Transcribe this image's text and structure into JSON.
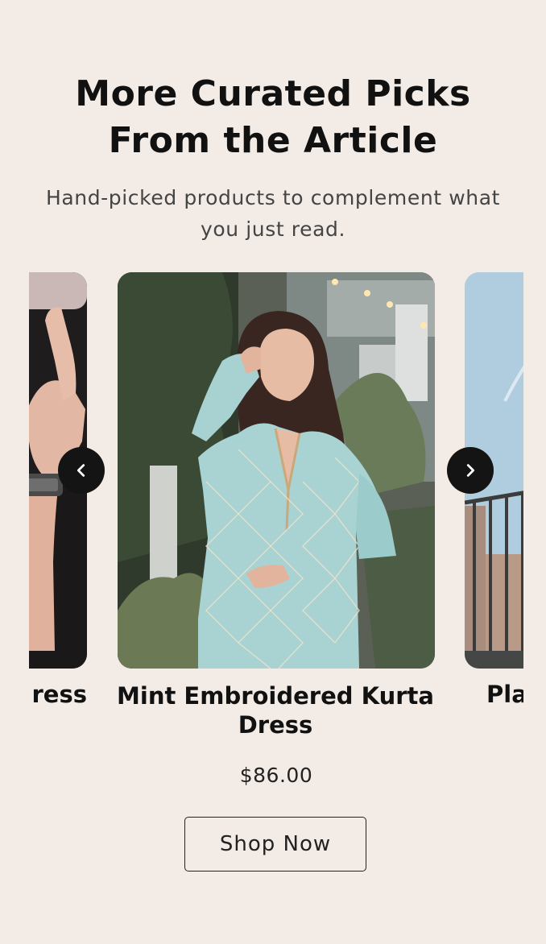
{
  "section": {
    "title_line1": "More Curated Picks",
    "title_line2": "From the Article",
    "subtitle_line1": "Hand-picked products to complement what",
    "subtitle_line2": "you just read."
  },
  "carousel": {
    "prev_icon": "chevron-left-icon",
    "next_icon": "chevron-right-icon",
    "items": [
      {
        "name_visible": "ress"
      },
      {
        "name_line1": "Mint Embroidered Kurta",
        "name_line2": "Dress",
        "price": "$86.00",
        "cta": "Shop Now"
      },
      {
        "name_visible": "Pla"
      }
    ]
  },
  "colors": {
    "background": "#f3ece6",
    "text": "#111111",
    "nav_button": "#141414"
  }
}
